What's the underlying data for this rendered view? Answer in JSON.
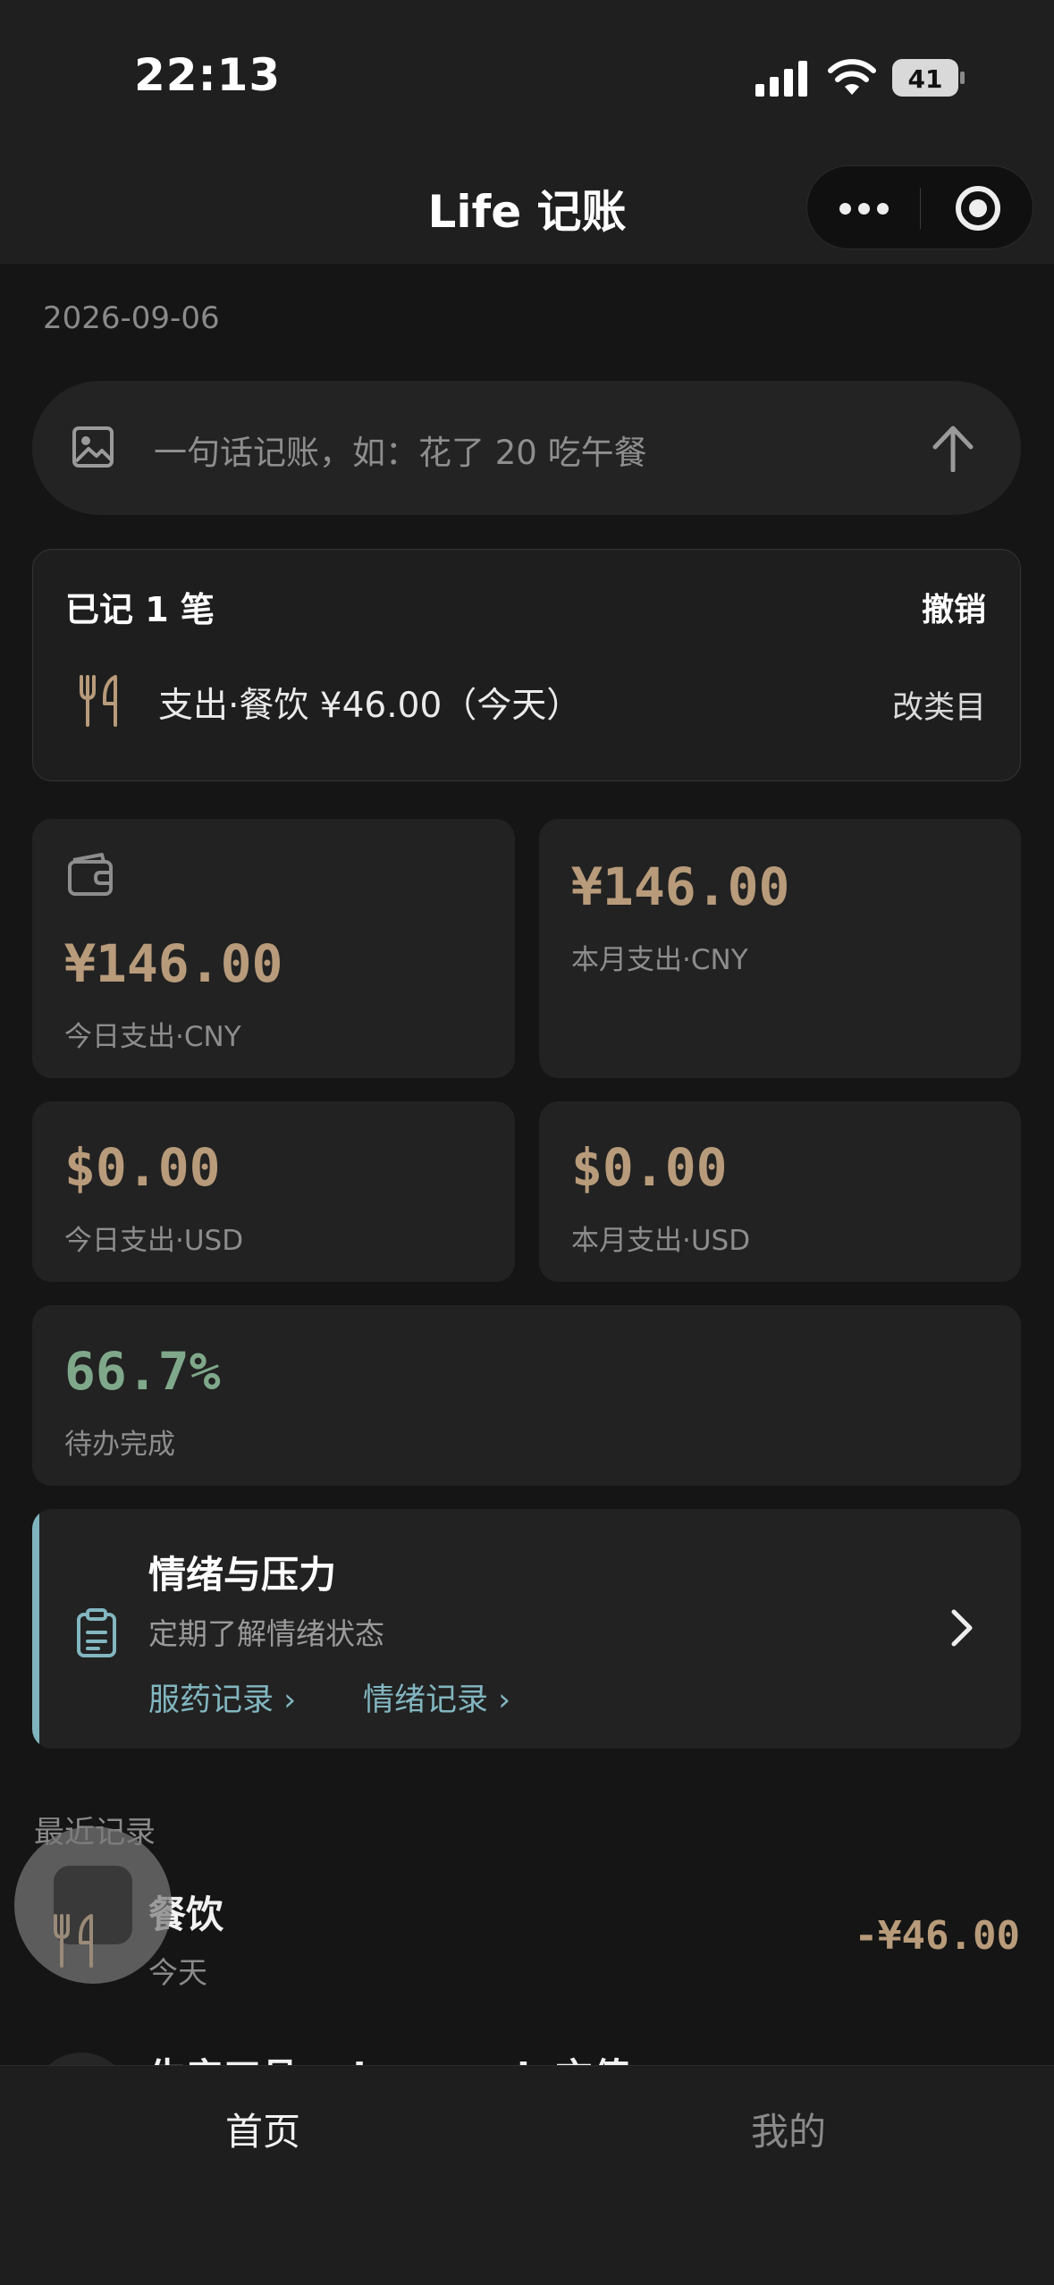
{
  "status_bar": {
    "time": "22:13",
    "battery": "41"
  },
  "nav": {
    "title": "Life 记账"
  },
  "date": "2026-09-06",
  "input": {
    "placeholder": "一句话记账，如：花了 20 吃午餐"
  },
  "recorded": {
    "title": "已记 1 笔",
    "undo_label": "撤销",
    "entry_text": "支出·餐饮 ¥46.00（今天）",
    "change_category_label": "改类目"
  },
  "stats": {
    "today_cny": {
      "value": "¥146.00",
      "label": "今日支出·CNY"
    },
    "month_cny": {
      "value": "¥146.00",
      "label": "本月支出·CNY"
    },
    "today_usd": {
      "value": "$0.00",
      "label": "今日支出·USD"
    },
    "month_usd": {
      "value": "$0.00",
      "label": "本月支出·USD"
    },
    "todo": {
      "value": "66.7%",
      "label": "待办完成"
    }
  },
  "mood_card": {
    "title": "情绪与压力",
    "subtitle": "定期了解情绪状态",
    "links": [
      "服药记录 ›",
      "情绪记录 ›"
    ]
  },
  "recent": {
    "title": "最近记录",
    "items": [
      {
        "title": "餐饮",
        "sub": "今天",
        "amount": "-¥46.00"
      },
      {
        "title": "生产工具 · deepseek 充值"
      }
    ]
  },
  "tabs": [
    "首页",
    "我的"
  ],
  "colors": {
    "accent_money": "#b89b7a",
    "accent_green": "#7fa88a",
    "accent_teal": "#82b6c0"
  }
}
